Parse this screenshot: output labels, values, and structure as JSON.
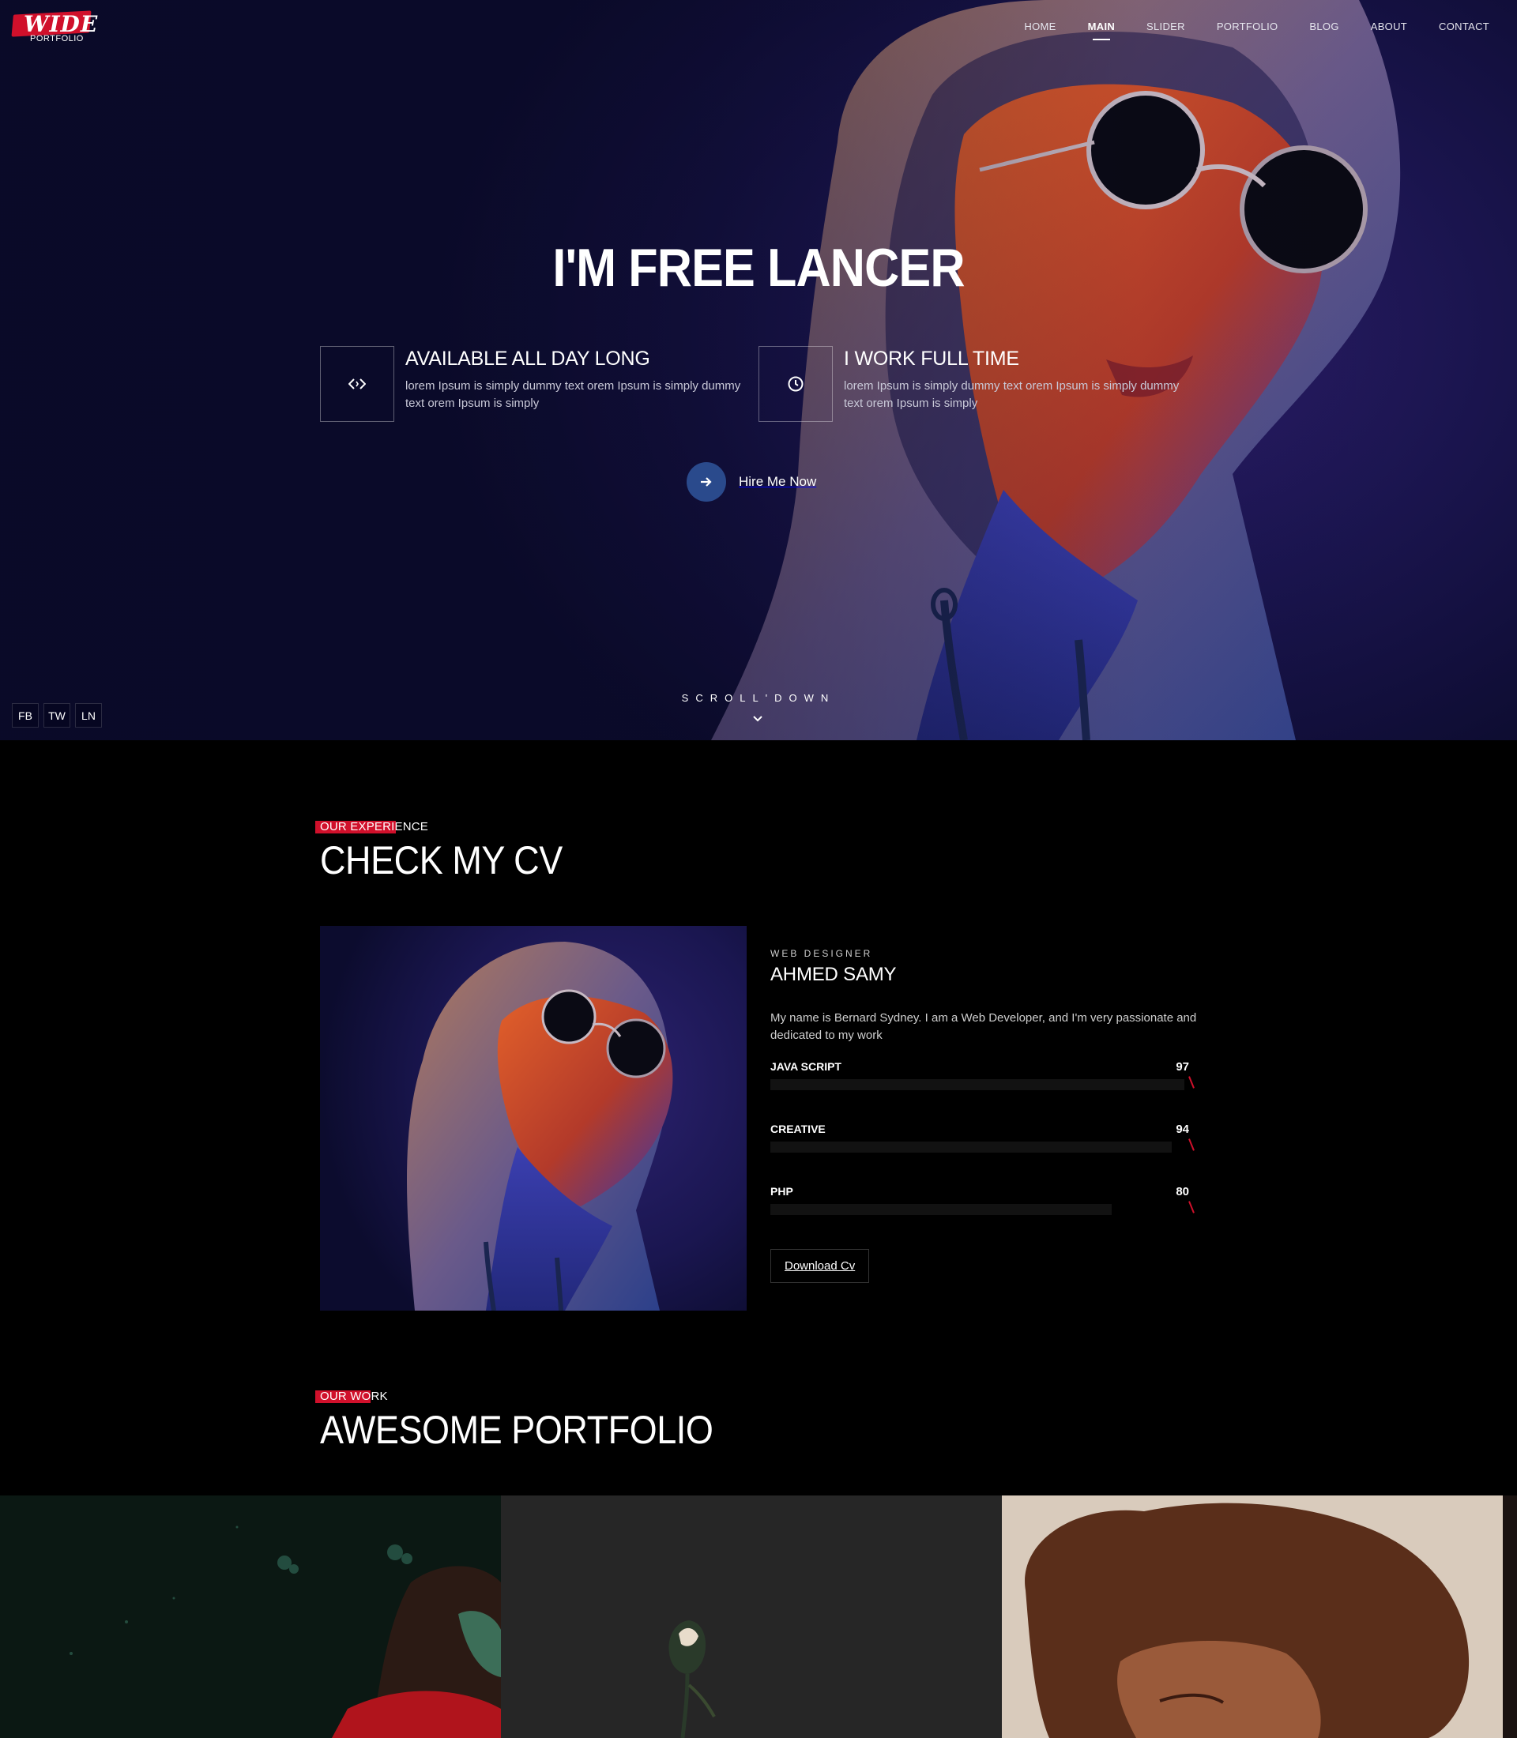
{
  "brand": {
    "word": "WIDE",
    "sub": "PORTFOLIO"
  },
  "nav": [
    "HOME",
    "MAIN",
    "SLIDER",
    "PORTFOLIO",
    "BLOG",
    "ABOUT",
    "CONTACT"
  ],
  "nav_active": "MAIN",
  "hero": {
    "title": "I'M FREE LANCER",
    "features": [
      {
        "icon": "code-icon",
        "title": "AVAILABLE ALL DAY LONG",
        "text": "lorem Ipsum is simply dummy text orem Ipsum is simply dummy text orem Ipsum is simply"
      },
      {
        "icon": "clock-icon",
        "title": "I WORK FULL TIME",
        "text": "lorem Ipsum is simply dummy text orem Ipsum is simply dummy text orem Ipsum is simply"
      }
    ],
    "cta": "Hire Me Now",
    "scroll": "SCROLL'DOWN",
    "socials": [
      "FB",
      "TW",
      "LN"
    ]
  },
  "cv": {
    "tag": "OUR EXPERIENCE",
    "title": "CHECK MY CV",
    "role": "WEB DESIGNER",
    "name": "AHMED SAMY",
    "bio": "My name is Bernard Sydney. I am a Web Developer, and I'm very passionate and dedicated to my work",
    "skills": [
      {
        "name": "JAVA SCRIPT",
        "value": 97
      },
      {
        "name": "CREATIVE",
        "value": 94
      },
      {
        "name": "PHP",
        "value": 80
      }
    ],
    "download": "Download Cv"
  },
  "portfolio": {
    "tag": "OUR WORK",
    "title": "AWESOME PORTFOLIO"
  },
  "colors": {
    "accent": "#d0102b",
    "hero_bg": "#151245",
    "button": "#2a4a8c"
  }
}
